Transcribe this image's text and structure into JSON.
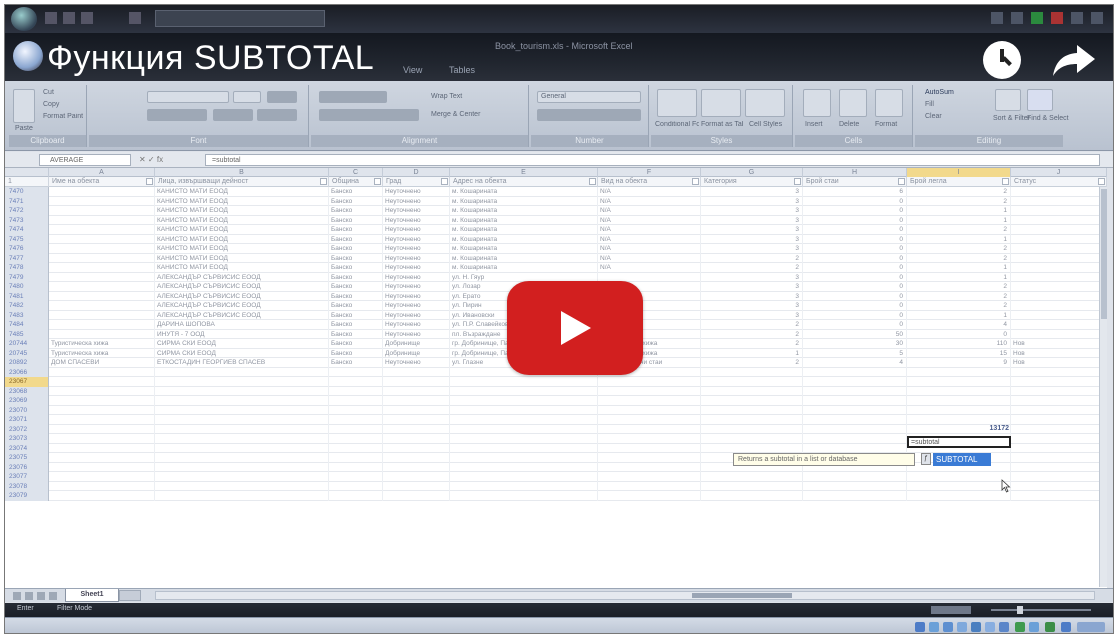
{
  "video": {
    "title": "Функция SUBTOTAL"
  },
  "window": {
    "app_title": "Book_tourism.xls - Microsoft Excel",
    "ribbon_tabs": [
      "View",
      "Tables"
    ]
  },
  "ribbon": {
    "groups": [
      "Clipboard",
      "Font",
      "Alignment",
      "Number",
      "Styles",
      "Cells",
      "Editing"
    ],
    "clipboard": {
      "paste": "Paste",
      "cut": "Cut",
      "copy": "Copy",
      "format_painter": "Format Painter"
    },
    "alignment": {
      "wrap": "Wrap Text",
      "merge": "Merge & Center"
    },
    "number": {
      "format": "General"
    },
    "styles": {
      "conditional": "Conditional Formatting",
      "format_table": "Format as Table",
      "cell_styles": "Cell Styles"
    },
    "cells": {
      "insert": "Insert",
      "delete": "Delete",
      "format": "Format"
    },
    "editing": {
      "autosum": "AutoSum",
      "fill": "Fill",
      "clear": "Clear",
      "sort": "Sort & Filter",
      "find": "Find & Select"
    }
  },
  "formula_bar": {
    "name_box": "AVERAGE",
    "fx": "✕ ✓ fx",
    "formula": "=subtotal"
  },
  "columns": {
    "letters": [
      "A",
      "B",
      "C",
      "D",
      "E",
      "F",
      "G",
      "H",
      "I",
      "J"
    ],
    "headers": [
      "Име на обекта",
      "Лица, извършващи дейност",
      "Община",
      "Град",
      "Адрес на обекта",
      "Вид на обекта",
      "Категория",
      "Брой стаи",
      "Брой легла",
      "Статус"
    ]
  },
  "rows": [
    {
      "n": "7470",
      "b": "КАНИСТО МАТИ ЕООД",
      "c": "Банско",
      "d": "Неуточнено",
      "e": "м. Кошарината",
      "f": "N/A",
      "g": "3",
      "h": "6",
      "i": "2",
      "j": ""
    },
    {
      "n": "7471",
      "b": "КАНИСТО МАТИ ЕООД",
      "c": "Банско",
      "d": "Неуточнено",
      "e": "м. Кошарината",
      "f": "N/A",
      "g": "3",
      "h": "0",
      "i": "2",
      "j": ""
    },
    {
      "n": "7472",
      "b": "КАНИСТО МАТИ ЕООД",
      "c": "Банско",
      "d": "Неуточнено",
      "e": "м. Кошарината",
      "f": "N/A",
      "g": "3",
      "h": "0",
      "i": "1",
      "j": ""
    },
    {
      "n": "7473",
      "b": "КАНИСТО МАТИ ЕООД",
      "c": "Банско",
      "d": "Неуточнено",
      "e": "м. Кошарината",
      "f": "N/A",
      "g": "3",
      "h": "0",
      "i": "1",
      "j": ""
    },
    {
      "n": "7474",
      "b": "КАНИСТО МАТИ ЕООД",
      "c": "Банско",
      "d": "Неуточнено",
      "e": "м. Кошарината",
      "f": "N/A",
      "g": "3",
      "h": "0",
      "i": "2",
      "j": ""
    },
    {
      "n": "7475",
      "b": "КАНИСТО МАТИ ЕООД",
      "c": "Банско",
      "d": "Неуточнено",
      "e": "м. Кошарината",
      "f": "N/A",
      "g": "3",
      "h": "0",
      "i": "1",
      "j": ""
    },
    {
      "n": "7476",
      "b": "КАНИСТО МАТИ ЕООД",
      "c": "Банско",
      "d": "Неуточнено",
      "e": "м. Кошарината",
      "f": "N/A",
      "g": "3",
      "h": "0",
      "i": "2",
      "j": ""
    },
    {
      "n": "7477",
      "b": "КАНИСТО МАТИ ЕООД",
      "c": "Банско",
      "d": "Неуточнено",
      "e": "м. Кошарината",
      "f": "N/A",
      "g": "2",
      "h": "0",
      "i": "2",
      "j": ""
    },
    {
      "n": "7478",
      "b": "КАНИСТО МАТИ ЕООД",
      "c": "Банско",
      "d": "Неуточнено",
      "e": "м. Кошарината",
      "f": "N/A",
      "g": "2",
      "h": "0",
      "i": "1",
      "j": ""
    },
    {
      "n": "7479",
      "b": "АЛЕКСАНДЪР СЪРВИСИС ЕООД",
      "c": "Банско",
      "d": "Неуточнено",
      "e": "ул. Н. Гяур",
      "f": "",
      "g": "3",
      "h": "0",
      "i": "1",
      "j": ""
    },
    {
      "n": "7480",
      "b": "АЛЕКСАНДЪР СЪРВИСИС ЕООД",
      "c": "Банско",
      "d": "Неуточнено",
      "e": "ул. Лозар",
      "f": "",
      "g": "3",
      "h": "0",
      "i": "2",
      "j": ""
    },
    {
      "n": "7481",
      "b": "АЛЕКСАНДЪР СЪРВИСИС ЕООД",
      "c": "Банско",
      "d": "Неуточнено",
      "e": "ул. Ерато",
      "f": "",
      "g": "3",
      "h": "0",
      "i": "2",
      "j": ""
    },
    {
      "n": "7482",
      "b": "АЛЕКСАНДЪР СЪРВИСИС ЕООД",
      "c": "Банско",
      "d": "Неуточнено",
      "e": "ул. Пирин",
      "f": "",
      "g": "3",
      "h": "0",
      "i": "2",
      "j": ""
    },
    {
      "n": "7483",
      "b": "АЛЕКСАНДЪР СЪРВИСИС ЕООД",
      "c": "Банско",
      "d": "Неуточнено",
      "e": "ул. Ивановски",
      "f": "",
      "g": "3",
      "h": "0",
      "i": "1",
      "j": ""
    },
    {
      "n": "7484",
      "b": "ДАРИНА ШОПОВА",
      "c": "Банско",
      "d": "Неуточнено",
      "e": "ул. П.Р. Славейков",
      "f": "",
      "g": "2",
      "h": "0",
      "i": "4",
      "j": ""
    },
    {
      "n": "7485",
      "b": "ИНУТЯ - 7 ООД",
      "c": "Банско",
      "d": "Неуточнено",
      "e": "пл. Възраждане",
      "f": "N/A",
      "g": "2",
      "h": "50",
      "i": "0",
      "j": ""
    },
    {
      "n": "20744",
      "a": "Туристическа хижа",
      "b": "СИРМА СКИ ЕООД",
      "c": "Банско",
      "d": "Добринище",
      "e": "гр. Добринище, Парк Пирин",
      "f": "Туристическа хижа",
      "g": "2",
      "h": "30",
      "i": "110",
      "j": "Нов"
    },
    {
      "n": "20745",
      "a": "Туристическа хижа",
      "b": "СИРМА СКИ ЕООД",
      "c": "Банско",
      "d": "Добринище",
      "e": "гр. Добринище, Парк Пирин",
      "f": "Туристическа хижа",
      "g": "1",
      "h": "5",
      "i": "15",
      "j": "Нов"
    },
    {
      "n": "20892",
      "a": "ДОМ СПАСЕВИ",
      "b": "ЕТКОСТАДИН ГЕОРГИЕВ СПАСЕВ",
      "c": "Банско",
      "d": "Неуточнено",
      "e": "ул. Глазне",
      "f": "Самостоятелни стаи",
      "g": "2",
      "h": "4",
      "i": "9",
      "j": "Нов"
    }
  ],
  "empty_rows": [
    "23066",
    "23067",
    "23068",
    "23069",
    "23070",
    "23071",
    "23072",
    "23073",
    "23074",
    "23075",
    "23076",
    "23077",
    "23078",
    "23079"
  ],
  "active_row": "23067",
  "total_value": "13172",
  "editing_text": "=subtotal",
  "tooltip": "Returns a subtotal in a list or database",
  "autocomplete": "SUBTOTAL",
  "sheet_tab": "Sheet1",
  "status": {
    "left": "Enter",
    "mode": "Filter Mode"
  }
}
